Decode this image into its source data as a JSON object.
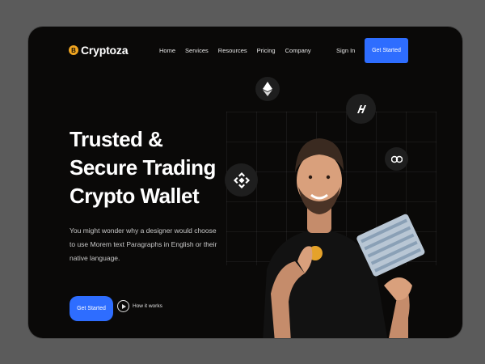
{
  "brand": {
    "name": "Cryptoza",
    "coin_glyph": "B"
  },
  "nav": {
    "items": [
      "Home",
      "Services",
      "Resources",
      "Pricing",
      "Company"
    ],
    "signin": "Sign In",
    "cta": "Get Started"
  },
  "hero": {
    "headline": [
      "Trusted &",
      "Secure Trading",
      "Crypto Wallet"
    ],
    "description": "You might wonder why a designer would choose to use Morem text Paragraphs in English or their native language.",
    "cta": "Get Started",
    "how_label": "How it works"
  },
  "tokens": {
    "icons": [
      "ethereum-icon",
      "harmony-icon",
      "binance-icon",
      "hedera-icon"
    ]
  },
  "colors": {
    "background": "#0a0908",
    "accent": "#2e6dff",
    "coin": "#f0a521",
    "outer": "#5b5b5b"
  }
}
